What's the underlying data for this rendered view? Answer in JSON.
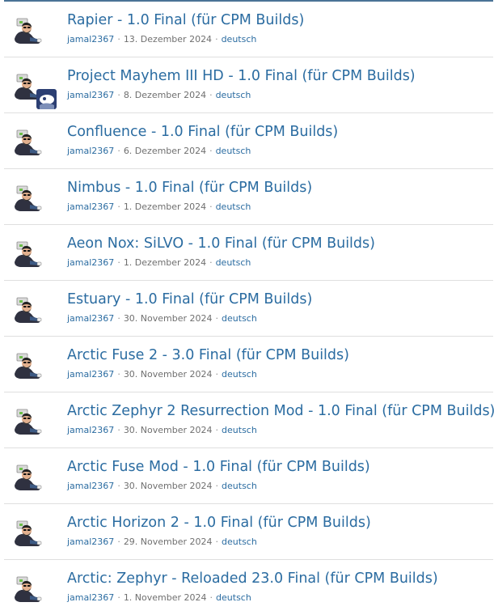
{
  "list": {
    "items": [
      {
        "title": "Rapier - 1.0 Final (für CPM Builds)",
        "author": "jamal2367",
        "date": "13. Dezember 2024",
        "language": "deutsch",
        "has_badge": false
      },
      {
        "title": "Project Mayhem III HD - 1.0 Final (für CPM Builds)",
        "author": "jamal2367",
        "date": "8. Dezember 2024",
        "language": "deutsch",
        "has_badge": true
      },
      {
        "title": "Confluence - 1.0 Final (für CPM Builds)",
        "author": "jamal2367",
        "date": "6. Dezember 2024",
        "language": "deutsch",
        "has_badge": false
      },
      {
        "title": "Nimbus - 1.0 Final (für CPM Builds)",
        "author": "jamal2367",
        "date": "1. Dezember 2024",
        "language": "deutsch",
        "has_badge": false
      },
      {
        "title": "Aeon Nox: SiLVO - 1.0 Final (für CPM Builds)",
        "author": "jamal2367",
        "date": "1. Dezember 2024",
        "language": "deutsch",
        "has_badge": false
      },
      {
        "title": "Estuary - 1.0 Final (für CPM Builds)",
        "author": "jamal2367",
        "date": "30. November 2024",
        "language": "deutsch",
        "has_badge": false
      },
      {
        "title": "Arctic Fuse 2 - 3.0 Final (für CPM Builds)",
        "author": "jamal2367",
        "date": "30. November 2024",
        "language": "deutsch",
        "has_badge": false
      },
      {
        "title": "Arctic Zephyr 2 Resurrection Mod - 1.0 Final (für CPM Builds)",
        "author": "jamal2367",
        "date": "30. November 2024",
        "language": "deutsch",
        "has_badge": false
      },
      {
        "title": "Arctic Fuse Mod - 1.0 Final (für CPM Builds)",
        "author": "jamal2367",
        "date": "30. November 2024",
        "language": "deutsch",
        "has_badge": false
      },
      {
        "title": "Arctic Horizon 2 - 1.0 Final (für CPM Builds)",
        "author": "jamal2367",
        "date": "29. November 2024",
        "language": "deutsch",
        "has_badge": false
      },
      {
        "title": "Arctic: Zephyr - Reloaded 23.0 Final (für CPM Builds)",
        "author": "jamal2367",
        "date": "1. November 2024",
        "language": "deutsch",
        "has_badge": false
      }
    ],
    "separator": "·"
  },
  "colors": {
    "link": "#2b6ca1",
    "meta": "#6f6f6f",
    "divider": "#dfdfdf",
    "top_border": "#4a7396"
  }
}
